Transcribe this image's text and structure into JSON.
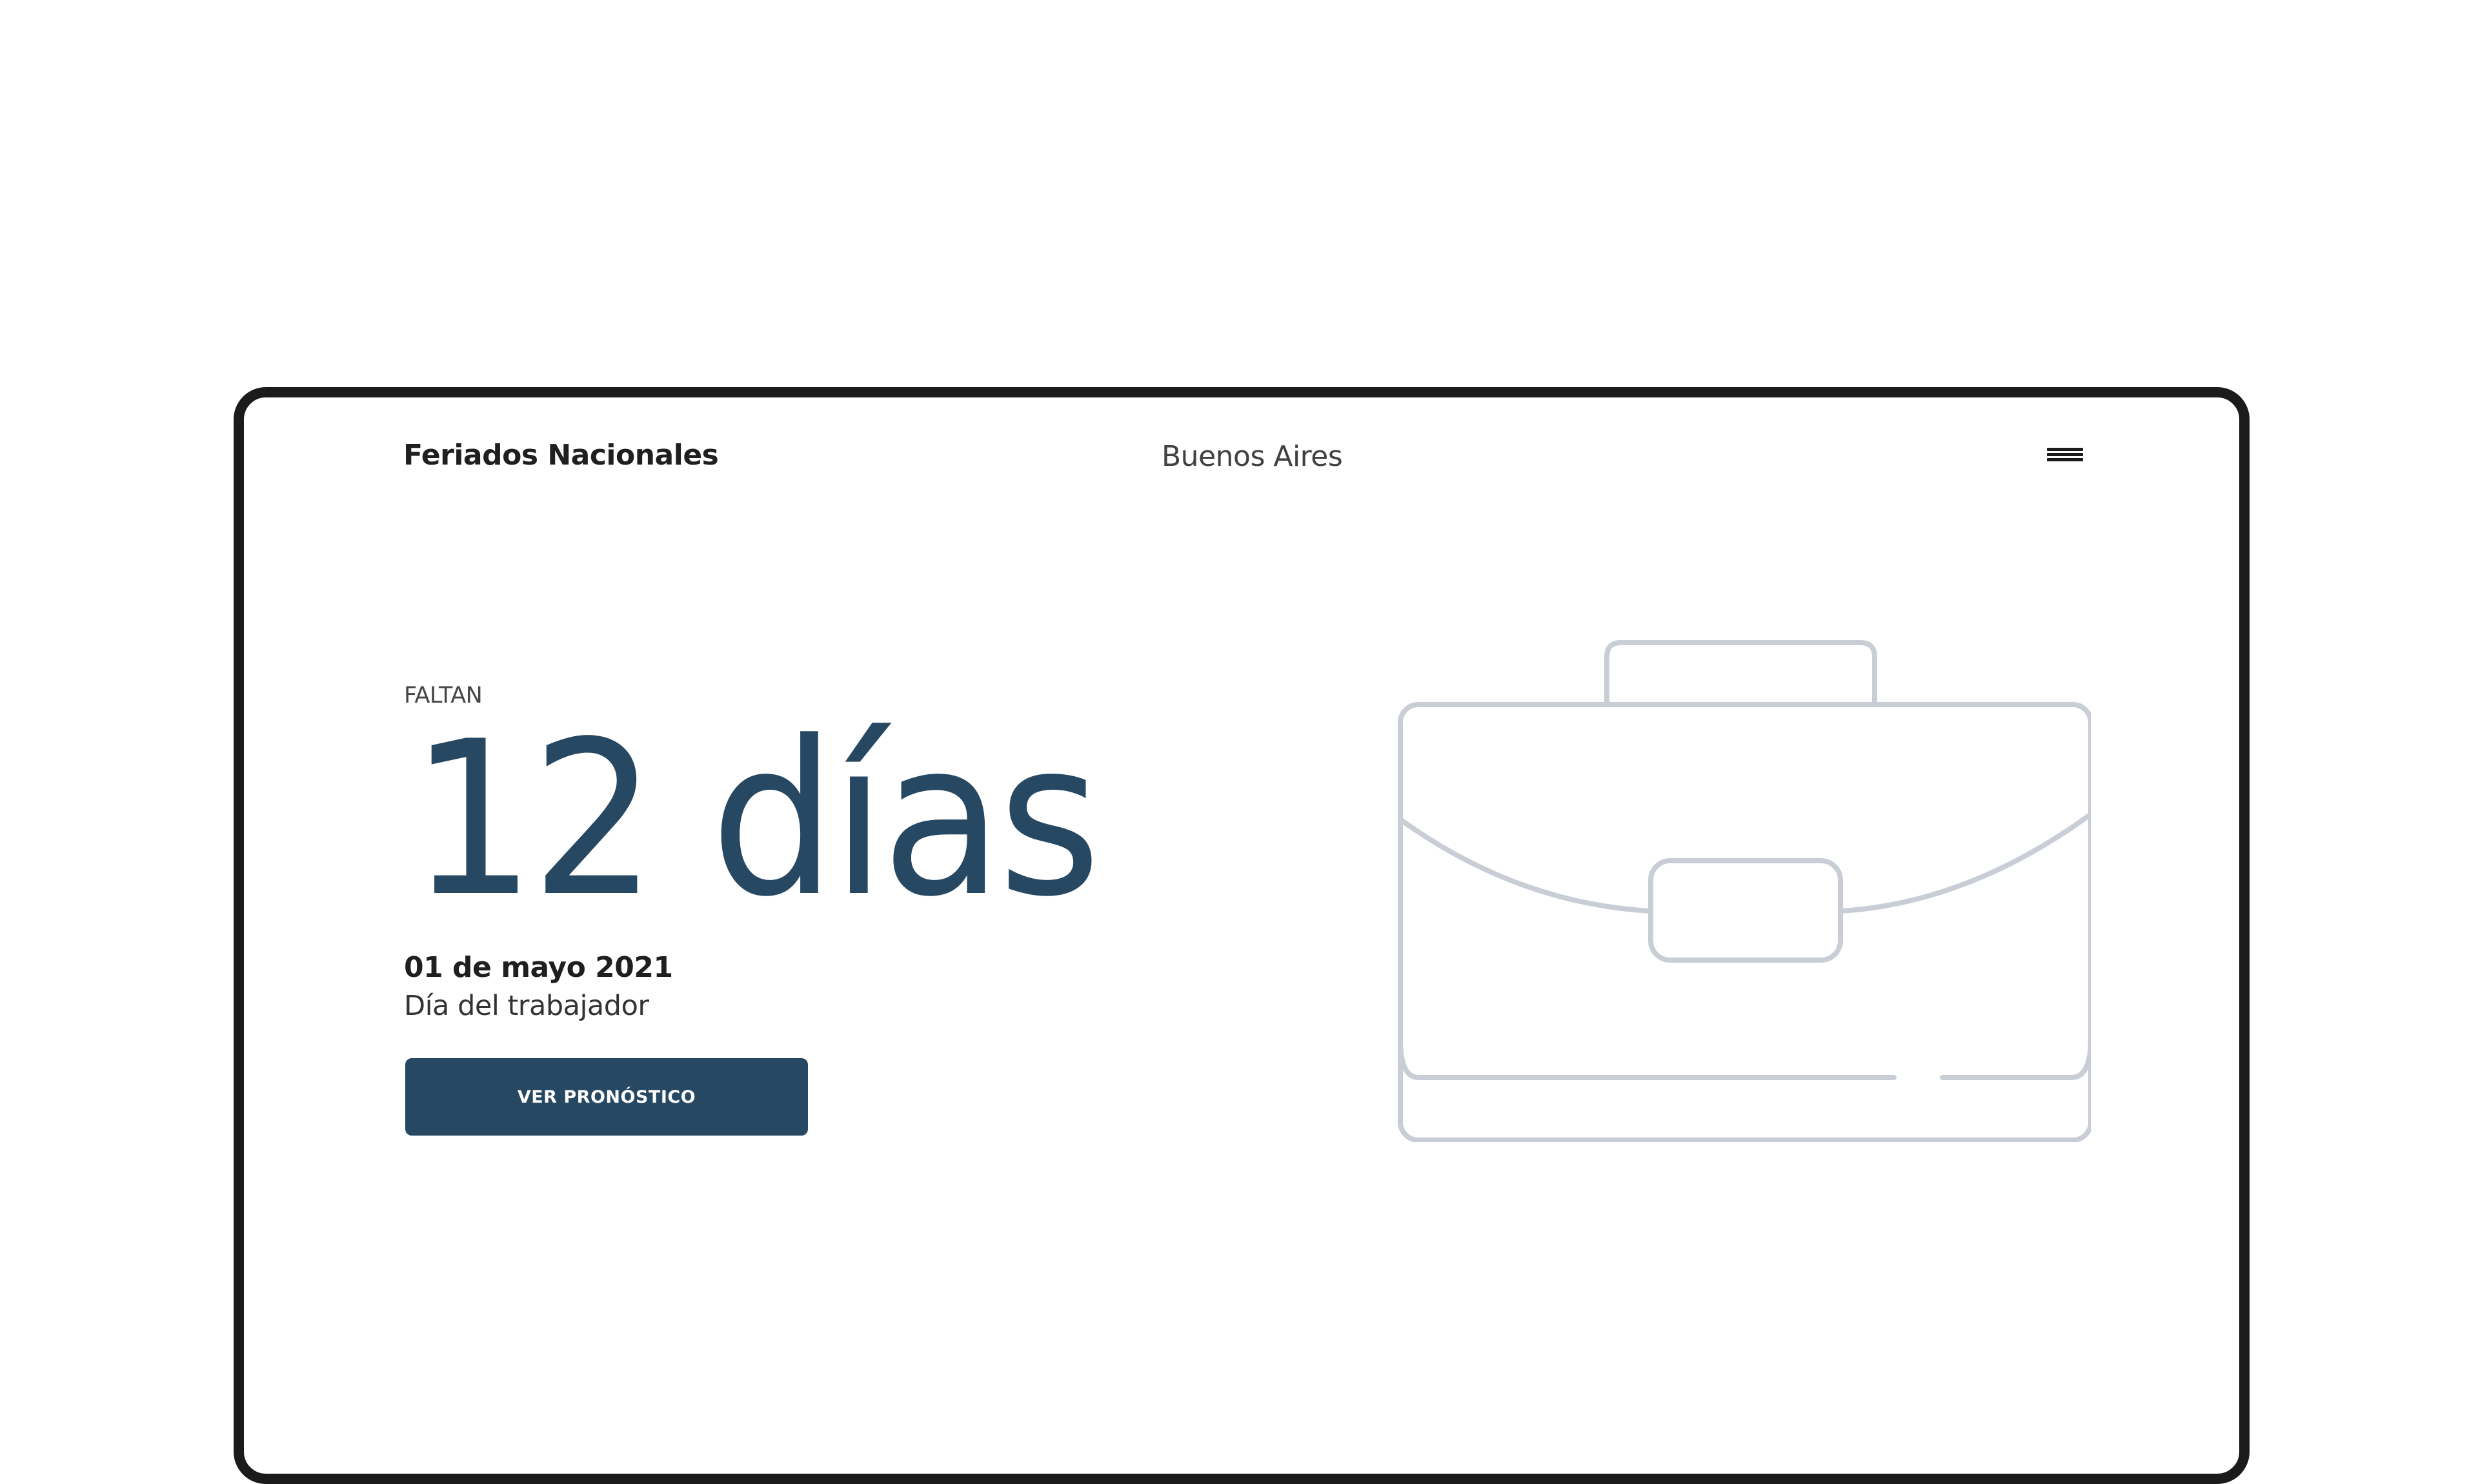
{
  "header": {
    "brand": "Feriados Nacionales",
    "location": "Buenos Aires",
    "menu_icon": "hamburger-menu-icon"
  },
  "main": {
    "eyebrow": "FALTAN",
    "countdown": "12 días",
    "date": "01 de mayo 2021",
    "holiday_name": "Día del trabajador",
    "cta_label": "VER PRONÓSTICO"
  },
  "illustration": {
    "icon": "briefcase-icon"
  },
  "colors": {
    "accent": "#274863",
    "illustration_stroke": "#c9ced6",
    "text": "#1f1f1f",
    "frame": "#1b1b1b",
    "background": "#ffffff"
  }
}
